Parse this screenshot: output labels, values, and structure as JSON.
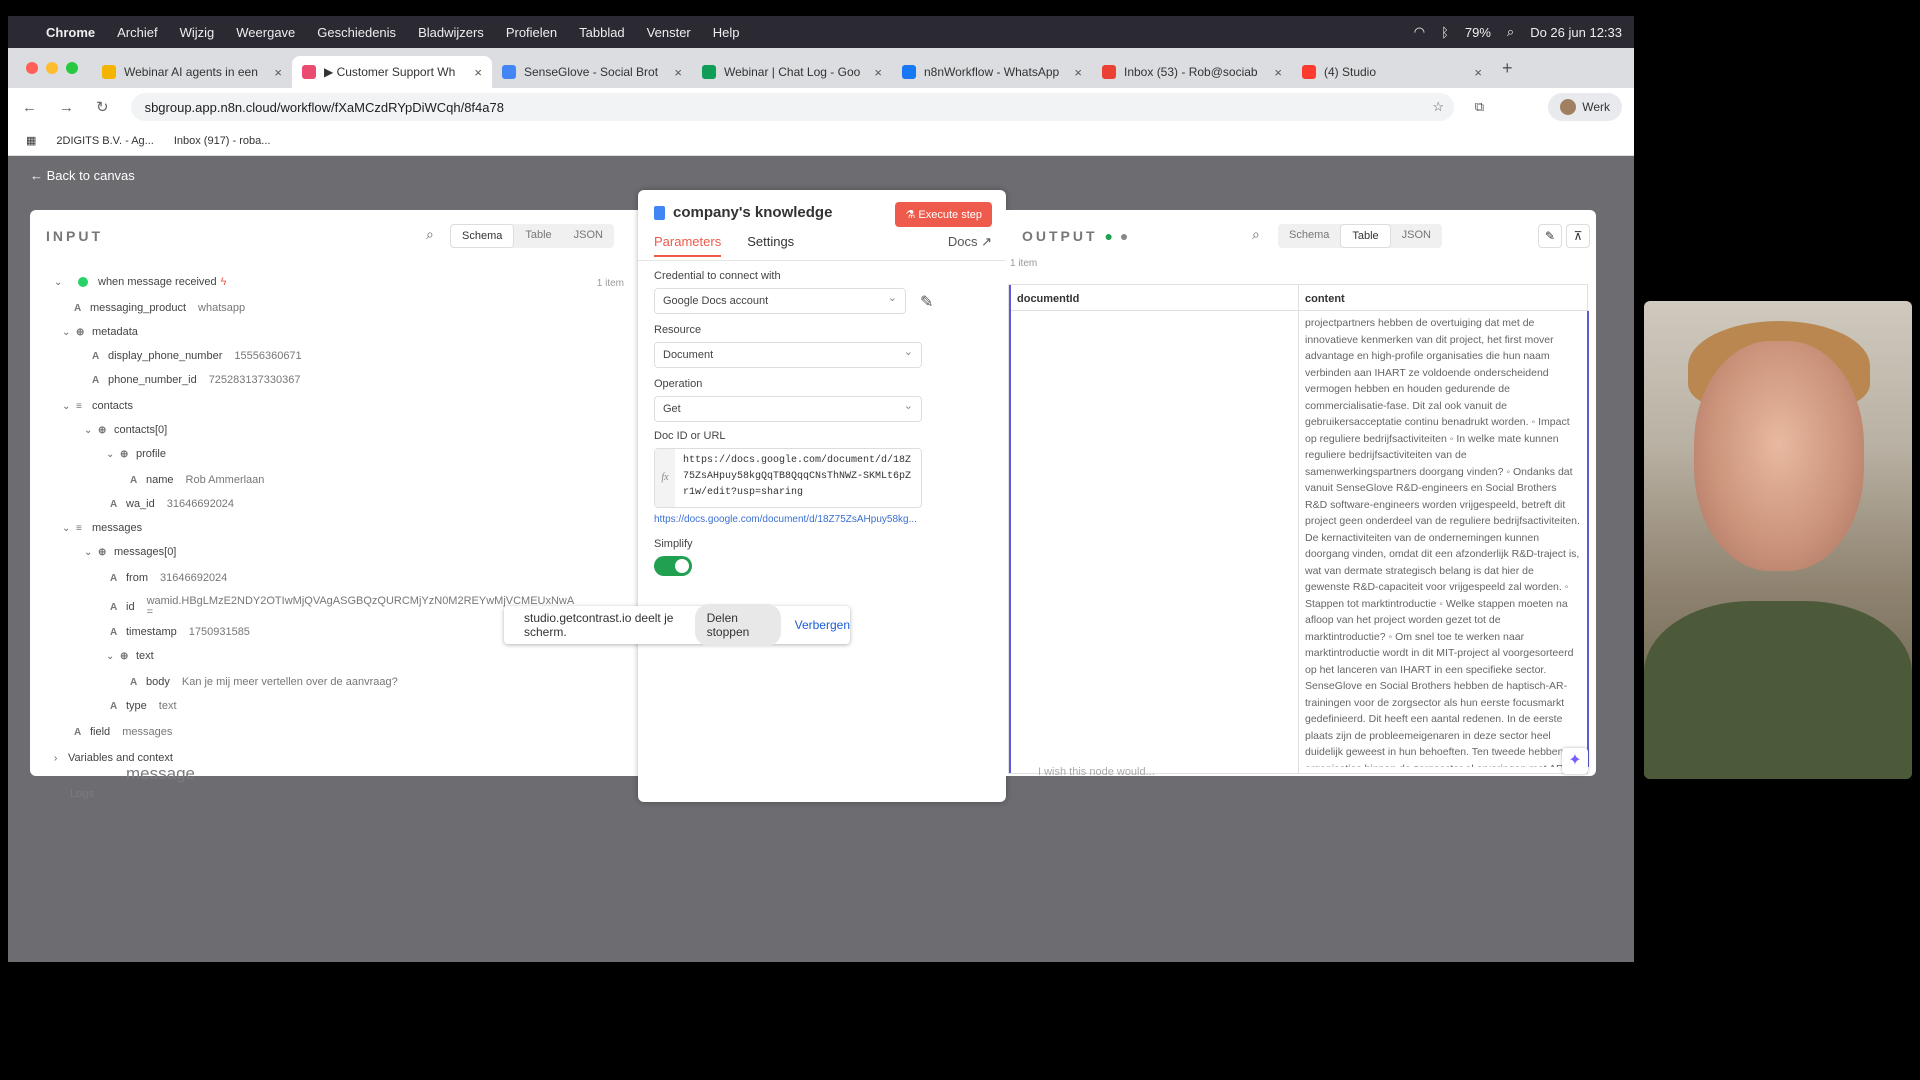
{
  "menubar": {
    "app": "Chrome",
    "items": [
      "Archief",
      "Wijzig",
      "Weergave",
      "Geschiedenis",
      "Bladwijzers",
      "Profielen",
      "Tabblad",
      "Venster",
      "Help"
    ],
    "battery": "79%",
    "datetime": "Do 26 jun  12:33"
  },
  "tabs": [
    {
      "label": "Webinar AI agents in een",
      "color": "#f4b400"
    },
    {
      "label": "▶ Customer Support Wh",
      "color": "#ea4b71",
      "active": true
    },
    {
      "label": "SenseGlove - Social Brot",
      "color": "#4285f4"
    },
    {
      "label": "Webinar | Chat Log - Goo",
      "color": "#0f9d58"
    },
    {
      "label": "n8nWorkflow - WhatsApp",
      "color": "#1877f2"
    },
    {
      "label": "Inbox (53) - Rob@sociab",
      "color": "#ea4335"
    },
    {
      "label": "(4) Studio",
      "color": "#ff3b30"
    }
  ],
  "address": "sbgroup.app.n8n.cloud/workflow/fXaMCzdRYpDiWCqh/8f4a78",
  "profile_label": "Werk",
  "bookmarks": [
    "2DIGITS B.V. - Ag...",
    "Inbox (917) - roba..."
  ],
  "back_label": "Back to canvas",
  "input": {
    "title": "INPUT",
    "views": [
      "Schema",
      "Table",
      "JSON"
    ],
    "item_count": "1 item",
    "trigger": "when message received",
    "rows": [
      {
        "key": "messaging_product",
        "val": "whatsapp"
      },
      {
        "key": "metadata",
        "val": ""
      },
      {
        "key": "display_phone_number",
        "val": "15556360671"
      },
      {
        "key": "phone_number_id",
        "val": "725283137330367"
      },
      {
        "key": "contacts",
        "val": ""
      },
      {
        "key": "contacts[0]",
        "val": ""
      },
      {
        "key": "profile",
        "val": ""
      },
      {
        "key": "name",
        "val": "Rob Ammerlaan"
      },
      {
        "key": "wa_id",
        "val": "31646692024"
      },
      {
        "key": "messages",
        "val": ""
      },
      {
        "key": "messages[0]",
        "val": ""
      },
      {
        "key": "from",
        "val": "31646692024"
      },
      {
        "key": "id",
        "val": "wamid.HBgLMzE2NDY2OTIwMjQVAgASGBQzQURCMjYzN0M2REYwMjVCMEUxNwA="
      },
      {
        "key": "timestamp",
        "val": "1750931585"
      },
      {
        "key": "text",
        "val": ""
      },
      {
        "key": "body",
        "val": "Kan je mij meer vertellen over de aanvraag?"
      },
      {
        "key": "type",
        "val": "text"
      },
      {
        "key": "field",
        "val": "messages"
      }
    ],
    "variables": "Variables and context"
  },
  "node": {
    "title": "company's knowledge",
    "execute": "Execute step",
    "tab_params": "Parameters",
    "tab_settings": "Settings",
    "docs": "Docs",
    "credential_label": "Credential to connect with",
    "credential": "Google Docs account",
    "resource_label": "Resource",
    "resource": "Document",
    "operation_label": "Operation",
    "operation": "Get",
    "docid_label": "Doc ID or URL",
    "docid": "https://docs.google.com/document/d/18Z75ZsAHpuy58kgQqTB8QqqCNsThNWZ-SKMLt6pZr1w/edit?usp=sharing",
    "docid_link": "https://docs.google.com/document/d/18Z75ZsAHpuy58kg...",
    "simplify_label": "Simplify"
  },
  "output": {
    "title": "OUTPUT",
    "views": [
      "Schema",
      "Table",
      "JSON"
    ],
    "item_count": "1 item",
    "col1": "documentId",
    "col2": "content",
    "content": "projectpartners hebben de overtuiging dat met de innovatieve kenmerken van dit project, het first mover advantage en high-profile organisaties die hun naam verbinden aan IHART ze voldoende onderscheidend vermogen hebben en houden gedurende de commercialisatie-fase. Dit zal ook vanuit de gebruikersacceptatie continu benadrukt worden. ◦ Impact op reguliere bedrijfsactiviteiten ◦ In welke mate kunnen reguliere bedrijfsactiviteiten van de samenwerkingspartners doorgang vinden? ◦ Ondanks dat vanuit SenseGlove R&D-engineers en Social Brothers R&D software-engineers worden vrijgespeeld, betreft dit project geen onderdeel van de reguliere bedrijfsactiviteiten. De kernactiviteiten van de ondernemingen kunnen doorgang vinden, omdat dit een afzonderlijk R&D-traject is, wat van dermate strategisch belang is dat hier de gewenste R&D-capaciteit voor vrijgespeeld zal worden. ◦ Stappen tot marktintroductie ◦ Welke stappen moeten na afloop van het project worden gezet tot de marktintroductie? ◦ Om snel toe te werken naar marktintroductie wordt in dit MIT-project al voorgesorteerd op het lanceren van IHART in een specifieke sector. SenseGlove en Social Brothers hebben de haptisch-AR-trainingen voor de zorgsector als hun eerste focusmarkt gedefinieerd. Dit heeft een aantal redenen. In de eerste plaats zijn de probleemeigenaren in deze sector heel duidelijk geweest in hun behoeften. Ten tweede hebben organisaties binnen de zorgsector al ervaringen met AR-oplossingen, waardoor de drempel tot adoptie beperkt is. Ten derde kennen de projectpartners de technologie waar hoog"
  },
  "share_bar": {
    "text": "studio.getcontrast.io deelt je scherm.",
    "stop": "Delen stoppen",
    "hide": "Verbergen"
  },
  "behind": {
    "message": "message",
    "logs": "Logs",
    "wish": "I wish this node would..."
  }
}
